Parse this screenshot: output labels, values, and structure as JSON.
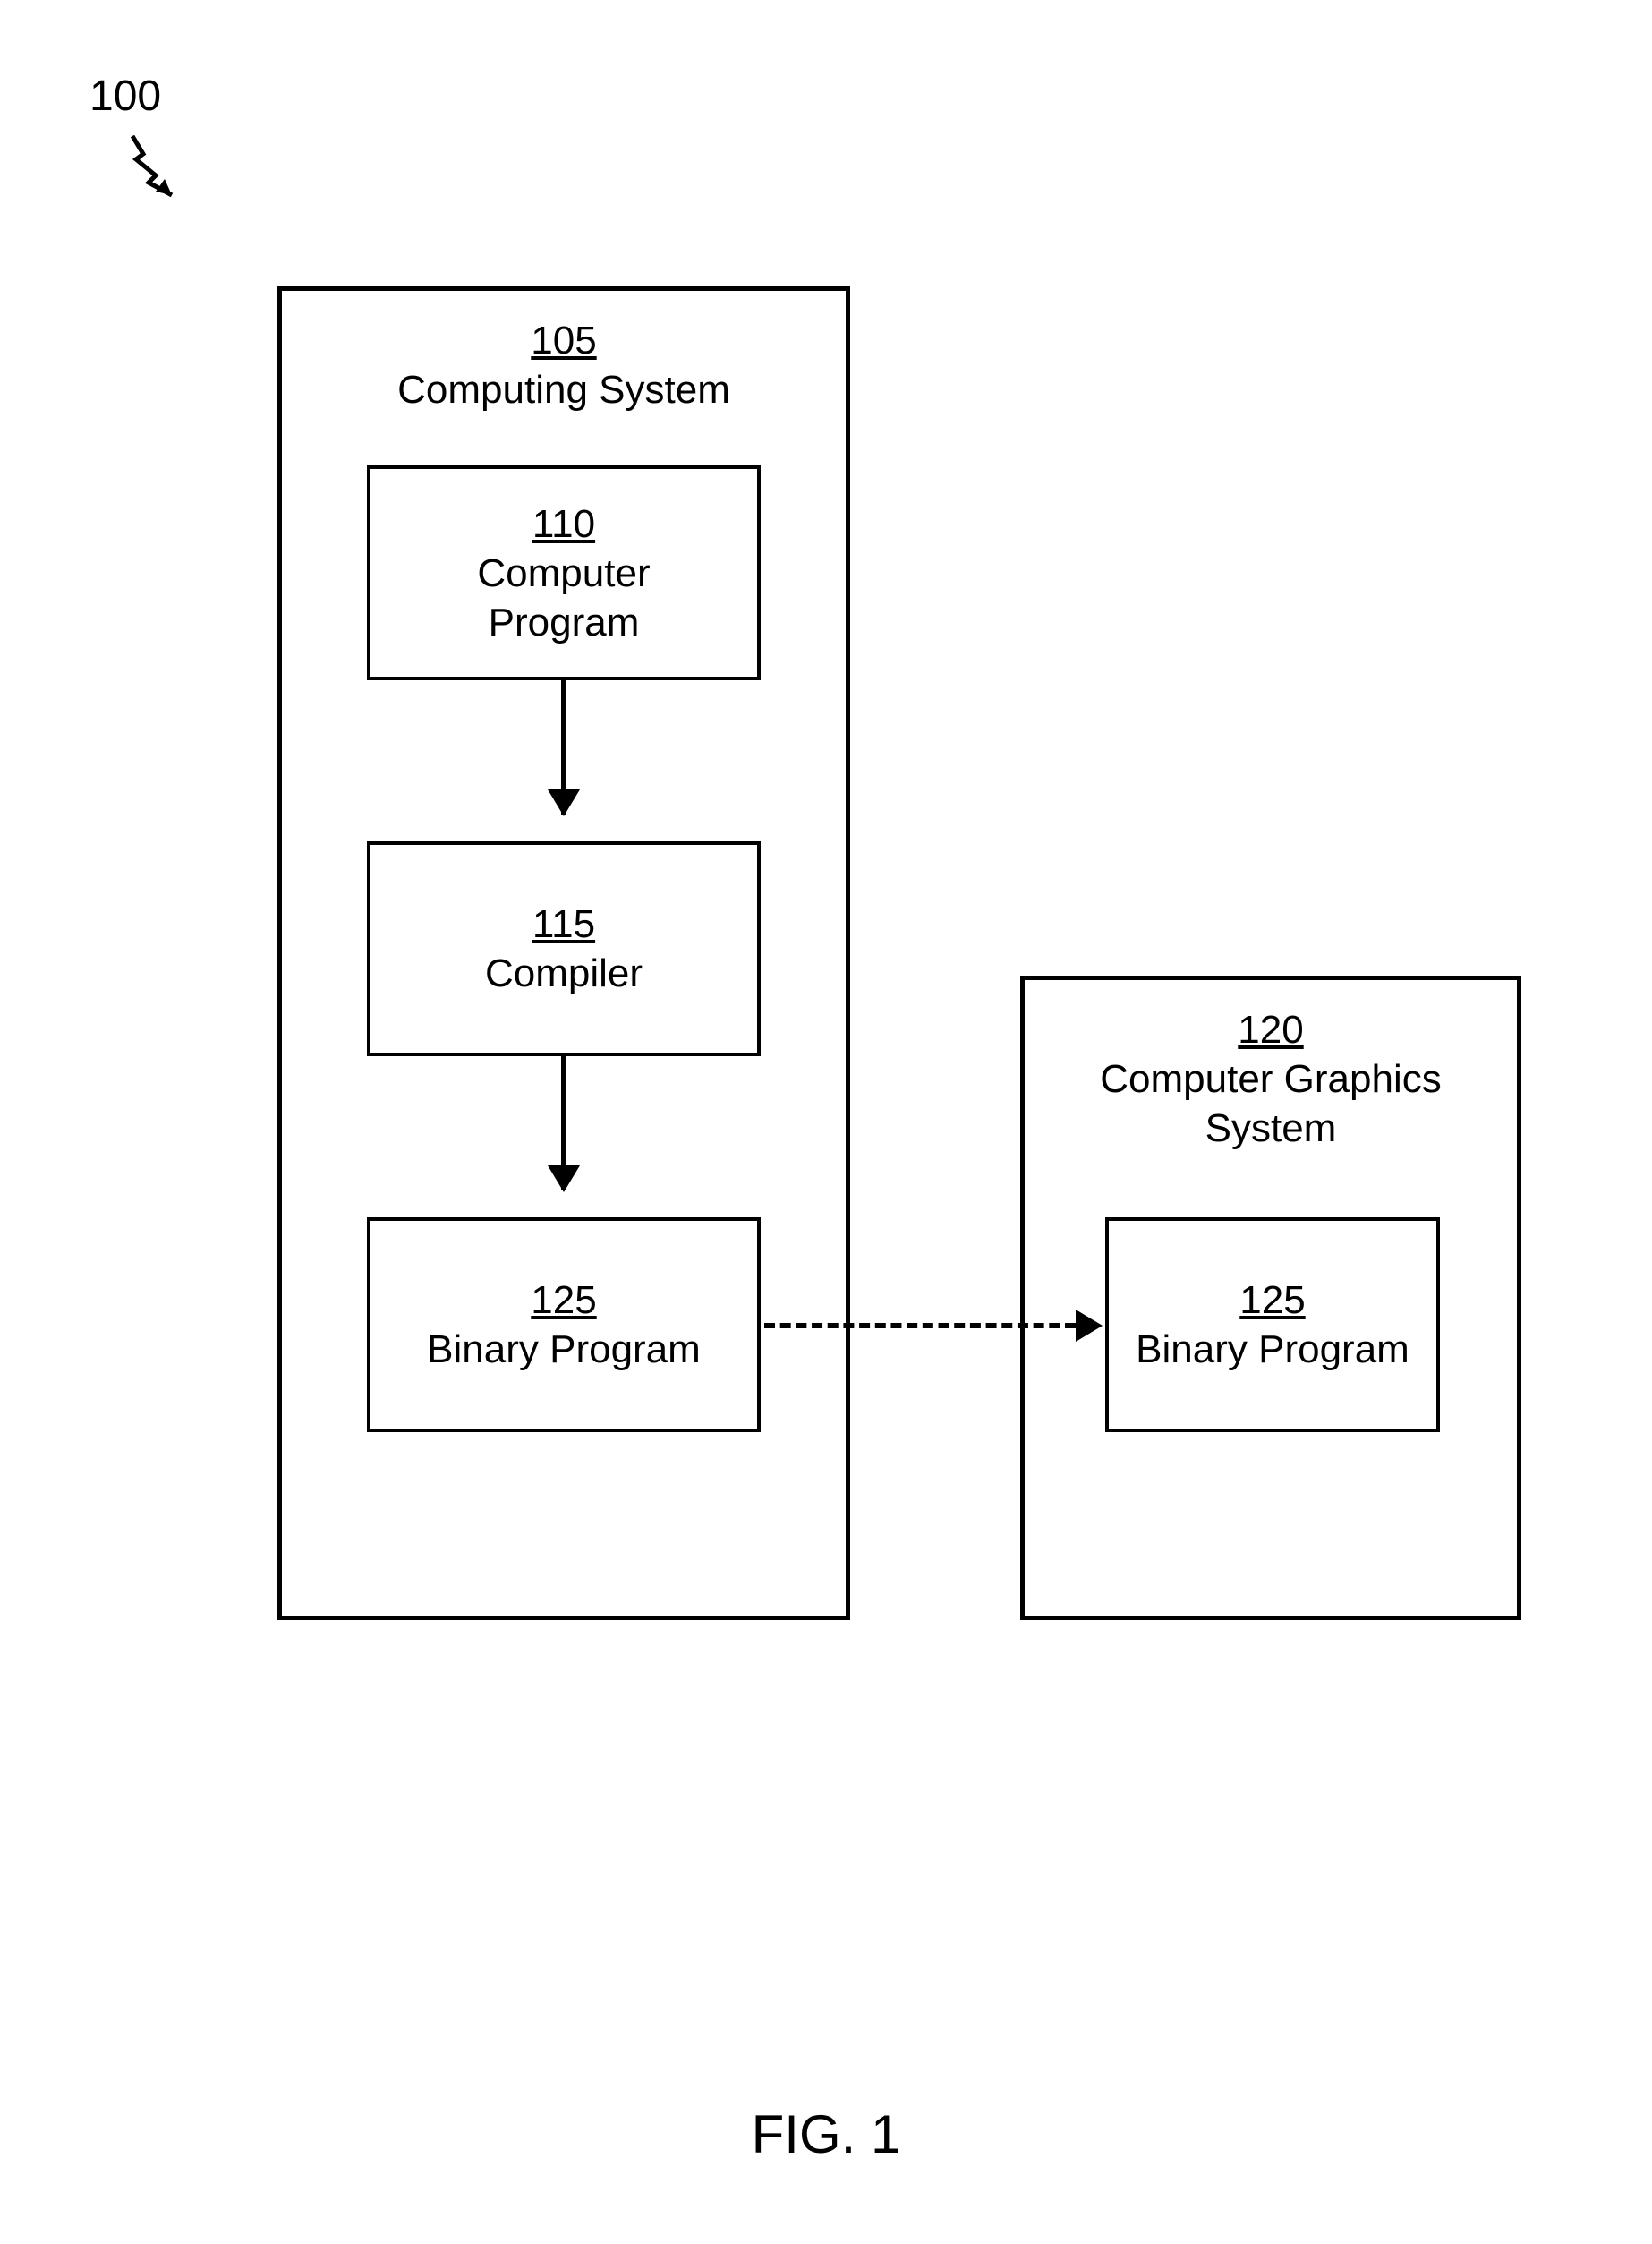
{
  "figure_ref": "100",
  "caption": "FIG. 1",
  "left_system": {
    "num": "105",
    "label": "Computing System"
  },
  "right_system": {
    "num": "120",
    "label_line1": "Computer Graphics",
    "label_line2": "System"
  },
  "box110": {
    "num": "110",
    "label_line1": "Computer",
    "label_line2": "Program"
  },
  "box115": {
    "num": "115",
    "label": "Compiler"
  },
  "box125a": {
    "num": "125",
    "label": "Binary Program"
  },
  "box125b": {
    "num": "125",
    "label": "Binary Program"
  }
}
